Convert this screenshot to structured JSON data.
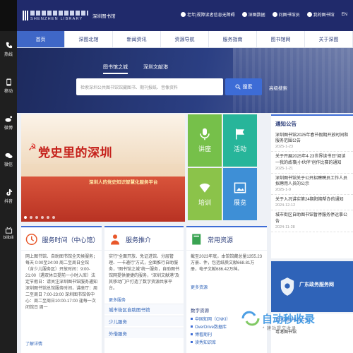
{
  "colors": {
    "header": "#202a6b",
    "accent": "#3d6cd6",
    "nav_active": "#3f67c7",
    "rail": "#1f1f1f"
  },
  "logo": {
    "en": "SHENZHEN LIBRARY",
    "cn": "深圳图书馆"
  },
  "top_links": [
    {
      "label": "老年|视障读者信息无障碍",
      "icon": "elder-icon"
    },
    {
      "label": "深图数据",
      "icon": "data-icon"
    },
    {
      "label": "问图书馆员",
      "icon": "chat-icon"
    },
    {
      "label": "我的图书馆",
      "icon": "user-icon"
    },
    {
      "label": "EN",
      "icon": ""
    }
  ],
  "rail": [
    {
      "label": "热线",
      "icon": "phone-icon"
    },
    {
      "label": "移动",
      "icon": "mobile-icon"
    },
    {
      "label": "微博",
      "icon": "weibo-icon"
    },
    {
      "label": "微信",
      "icon": "wechat-icon"
    },
    {
      "label": "抖音",
      "icon": "douyin-icon"
    },
    {
      "label": "bilibili",
      "icon": "bilibili-icon"
    }
  ],
  "nav": [
    {
      "label": "首页",
      "active": true
    },
    {
      "label": "深图北馆",
      "active": false
    },
    {
      "label": "新闻资讯",
      "active": false
    },
    {
      "label": "资源导航",
      "active": false
    },
    {
      "label": "服务指南",
      "active": false
    },
    {
      "label": "图书馆网",
      "active": false
    },
    {
      "label": "关于深图",
      "active": false
    }
  ],
  "search": {
    "tabs": [
      "图书馆之城",
      "深圳文献港"
    ],
    "placeholder": "检索深圳公共图书馆馆藏图书、期刊报纸、音像资料",
    "button": "搜索",
    "advanced": "高级搜索"
  },
  "banner": {
    "title": "党史里的深圳",
    "subtitle": "深圳人的党史知识智慧化服务平台",
    "slide_count": 6
  },
  "tiles": [
    {
      "label": "讲座",
      "icon": "microphone-icon"
    },
    {
      "label": "活动",
      "icon": "flag-icon"
    },
    {
      "label": "培训",
      "icon": "fan-icon"
    },
    {
      "label": "展览",
      "icon": "painting-icon"
    }
  ],
  "notices": {
    "title": "通知公告",
    "more": "",
    "items": [
      {
        "title": "深圳图书馆2025年春节假期开放时间和服务范围公告",
        "date": "2025-1-23"
      },
      {
        "title": "关于开展2025年4·23世界读书日“阅读一我的故事|小伙伴”创作比赛的通知",
        "date": "2025-1-21"
      },
      {
        "title": "深圳图书馆关于公开招聘聘员工作人员拟聘用人员的公示",
        "date": "2025-1-9"
      },
      {
        "title": "关于入况讲实第24期阳期帮办的通知",
        "date": "2024-12-12"
      },
      {
        "title": "城市街区自助图书馆暂停服务停运事公告",
        "date": "2024-11-28"
      }
    ]
  },
  "hours": {
    "title": "服务时间（中心馆）",
    "body": "网上图书馆、自助图书馆全天候服务；每天 0:00至24:00 周二至周日全馆（含少儿服务区）开放时间：9:00-21:00（遇双休日提前一小时入库）法定节假日：请关注深圳图书馆服务通知 深圳图书馆总馆服务时间，讲座厅：周二至周日 7:00-23:00 深圳图书馆各中心：周二至周日10:00-17:00 逢每一次闭馆日 周一",
    "more": "了解详情"
  },
  "recommend": {
    "title": "服务推介",
    "body": "实行“全面开放、免证进馆、分层管理、一卡通行”方式，全面推行自助服务，“图书馆之城”统一服务，自助图书馆网提供便捷的服务，“深圳文献港”及其移动门户打造了数字资源共享平台。",
    "more": "更多服务",
    "items": [
      "城市街区自助图书馆",
      "少儿服务",
      "外借服务"
    ]
  },
  "resources": {
    "title": "常用资源",
    "body": "截至2023年底，本馆馆藏总量1355.23万册、件，包括纸质文献668.81万册，电子文献686.42万种。",
    "more": "更多资源",
    "digital_title": "数字资源",
    "links": [
      "中国知网（CNKI）",
      "OverDrive数据库",
      "博看期刊",
      "读秀知识库"
    ]
  },
  "gov": {
    "name": "广东政务服务网",
    "lines": [
      "粤港澳图书馆合作",
      "粤港图书馆"
    ]
  },
  "watermark": {
    "text": "自动秒收录",
    "sub": "* 建站提交收录"
  }
}
